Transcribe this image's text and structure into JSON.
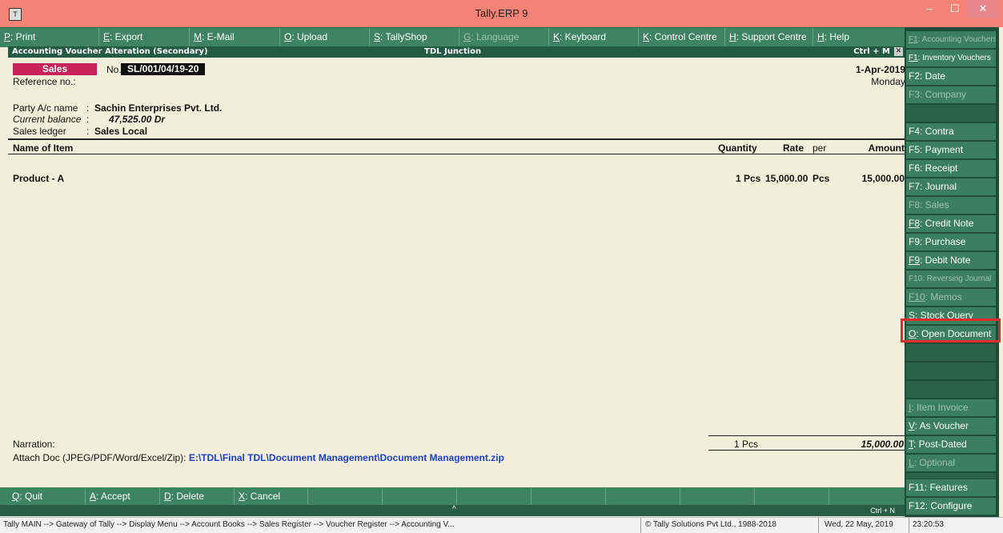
{
  "window": {
    "title": "Tally.ERP 9",
    "controls": {
      "minimize": "–",
      "maximize": "☐",
      "close": "✕"
    },
    "app_icon": "tally-icon"
  },
  "menubar": [
    {
      "key": "P",
      "label": ": Print",
      "enabled": true
    },
    {
      "key": "E",
      "label": ": Export",
      "enabled": true
    },
    {
      "key": "M",
      "label": ": E-Mail",
      "enabled": true
    },
    {
      "key": "O",
      "label": ": Upload",
      "enabled": true
    },
    {
      "key": "S",
      "label": ": TallyShop",
      "enabled": true
    },
    {
      "key": "G",
      "label": ": Language",
      "enabled": false
    },
    {
      "key": "K",
      "label": ": Keyboard",
      "enabled": true
    },
    {
      "key": "K",
      "label": ": Control Centre",
      "enabled": true
    },
    {
      "key": "H",
      "label": ": Support Centre",
      "enabled": true
    },
    {
      "key": "H",
      "label": ": Help",
      "enabled": true
    }
  ],
  "infobar": {
    "left": "Accounting Voucher  Alteration  (Secondary)",
    "center": "TDL Junction",
    "shortcut": "Ctrl + M",
    "close": "✕"
  },
  "voucher": {
    "type": "Sales",
    "no_label": "No.",
    "number": "SL/001/04/19-20",
    "reference_label": "Reference no.:",
    "date": "1-Apr-2019",
    "day": "Monday",
    "party_label": "Party A/c name",
    "party_sep": ":",
    "party": "Sachin Enterprises Pvt. Ltd.",
    "balance_label": "Current balance",
    "balance_sep": ":",
    "balance": "47,525.00 Dr",
    "ledger_label": "Sales ledger",
    "ledger_sep": ":",
    "ledger": "Sales Local"
  },
  "columns": {
    "name": "Name of Item",
    "quantity": "Quantity",
    "rate": "Rate",
    "per": "per",
    "amount": "Amount"
  },
  "items": [
    {
      "name": "Product - A",
      "quantity": "1 Pcs",
      "rate": "15,000.00",
      "per": "Pcs",
      "amount": "15,000.00"
    }
  ],
  "totals": {
    "quantity": "1 Pcs",
    "amount": "15,000.00"
  },
  "narration_label": "Narration:",
  "attach": {
    "label": "Attach Doc (JPEG/PDF/Word/Excel/Zip):",
    "path": "E:\\TDL\\Final TDL\\Document Management\\Document Management.zip"
  },
  "bottombar": [
    {
      "key": "Q",
      "label": ": Quit"
    },
    {
      "key": "A",
      "label": ": Accept"
    },
    {
      "key": "D",
      "label": ": Delete"
    },
    {
      "key": "X",
      "label": ": Cancel"
    }
  ],
  "bottom_caret": "^",
  "bottom_shortcut": "Ctrl + N",
  "statusbar": {
    "path": "Tally MAIN --> Gateway of Tally --> Display Menu --> Account Books --> Sales Register --> Voucher Register --> Accounting V...",
    "copyright": "© Tally Solutions Pvt Ltd., 1988-2018",
    "date": "Wed, 22 May, 2019",
    "time": "23:20:53"
  },
  "rightpanel": [
    {
      "key": "F1",
      "label": ": Accounting Vouchers",
      "enabled": false,
      "small": true
    },
    {
      "key": "F1",
      "label": ": Inventory Vouchers",
      "enabled": true,
      "small": true
    },
    {
      "key": "F2",
      "label": ": Date",
      "enabled": true
    },
    {
      "key": "F3",
      "label": ": Company",
      "enabled": false
    },
    {
      "key": "",
      "label": "",
      "enabled": false,
      "blank": true
    },
    {
      "key": "F4",
      "label": ": Contra",
      "enabled": true
    },
    {
      "key": "F5",
      "label": ": Payment",
      "enabled": true
    },
    {
      "key": "F6",
      "label": ": Receipt",
      "enabled": true
    },
    {
      "key": "F7",
      "label": ": Journal",
      "enabled": true
    },
    {
      "key": "F8",
      "label": ": Sales",
      "enabled": false
    },
    {
      "key": "F8",
      "label": ": Credit Note",
      "enabled": true
    },
    {
      "key": "F9",
      "label": ": Purchase",
      "enabled": true
    },
    {
      "key": "F9",
      "label": ": Debit Note",
      "enabled": true
    },
    {
      "key": "F10",
      "label": ": Reversing Journal",
      "enabled": false,
      "small": true
    },
    {
      "key": "F10",
      "label": ": Memos",
      "enabled": false
    },
    {
      "key": "S",
      "label": ": Stock Query",
      "enabled": true
    },
    {
      "key": "O",
      "label": ": Open Document",
      "enabled": true
    },
    {
      "key": "",
      "label": "",
      "enabled": false,
      "blank": true
    },
    {
      "key": "",
      "label": "",
      "enabled": false,
      "blank": true
    },
    {
      "key": "",
      "label": "",
      "enabled": false,
      "blank": true
    },
    {
      "key": "I",
      "label": ": Item Invoice",
      "enabled": false
    },
    {
      "key": "V",
      "label": ": As Voucher",
      "enabled": true
    },
    {
      "key": "T",
      "label": ": Post-Dated",
      "enabled": true
    },
    {
      "key": "L",
      "label": ": Optional",
      "enabled": false
    },
    {
      "key": "",
      "label": "",
      "enabled": false,
      "blank": true
    },
    {
      "key": "F11",
      "label": ": Features",
      "enabled": true
    },
    {
      "key": "F12",
      "label": ": Configure",
      "enabled": true
    }
  ]
}
